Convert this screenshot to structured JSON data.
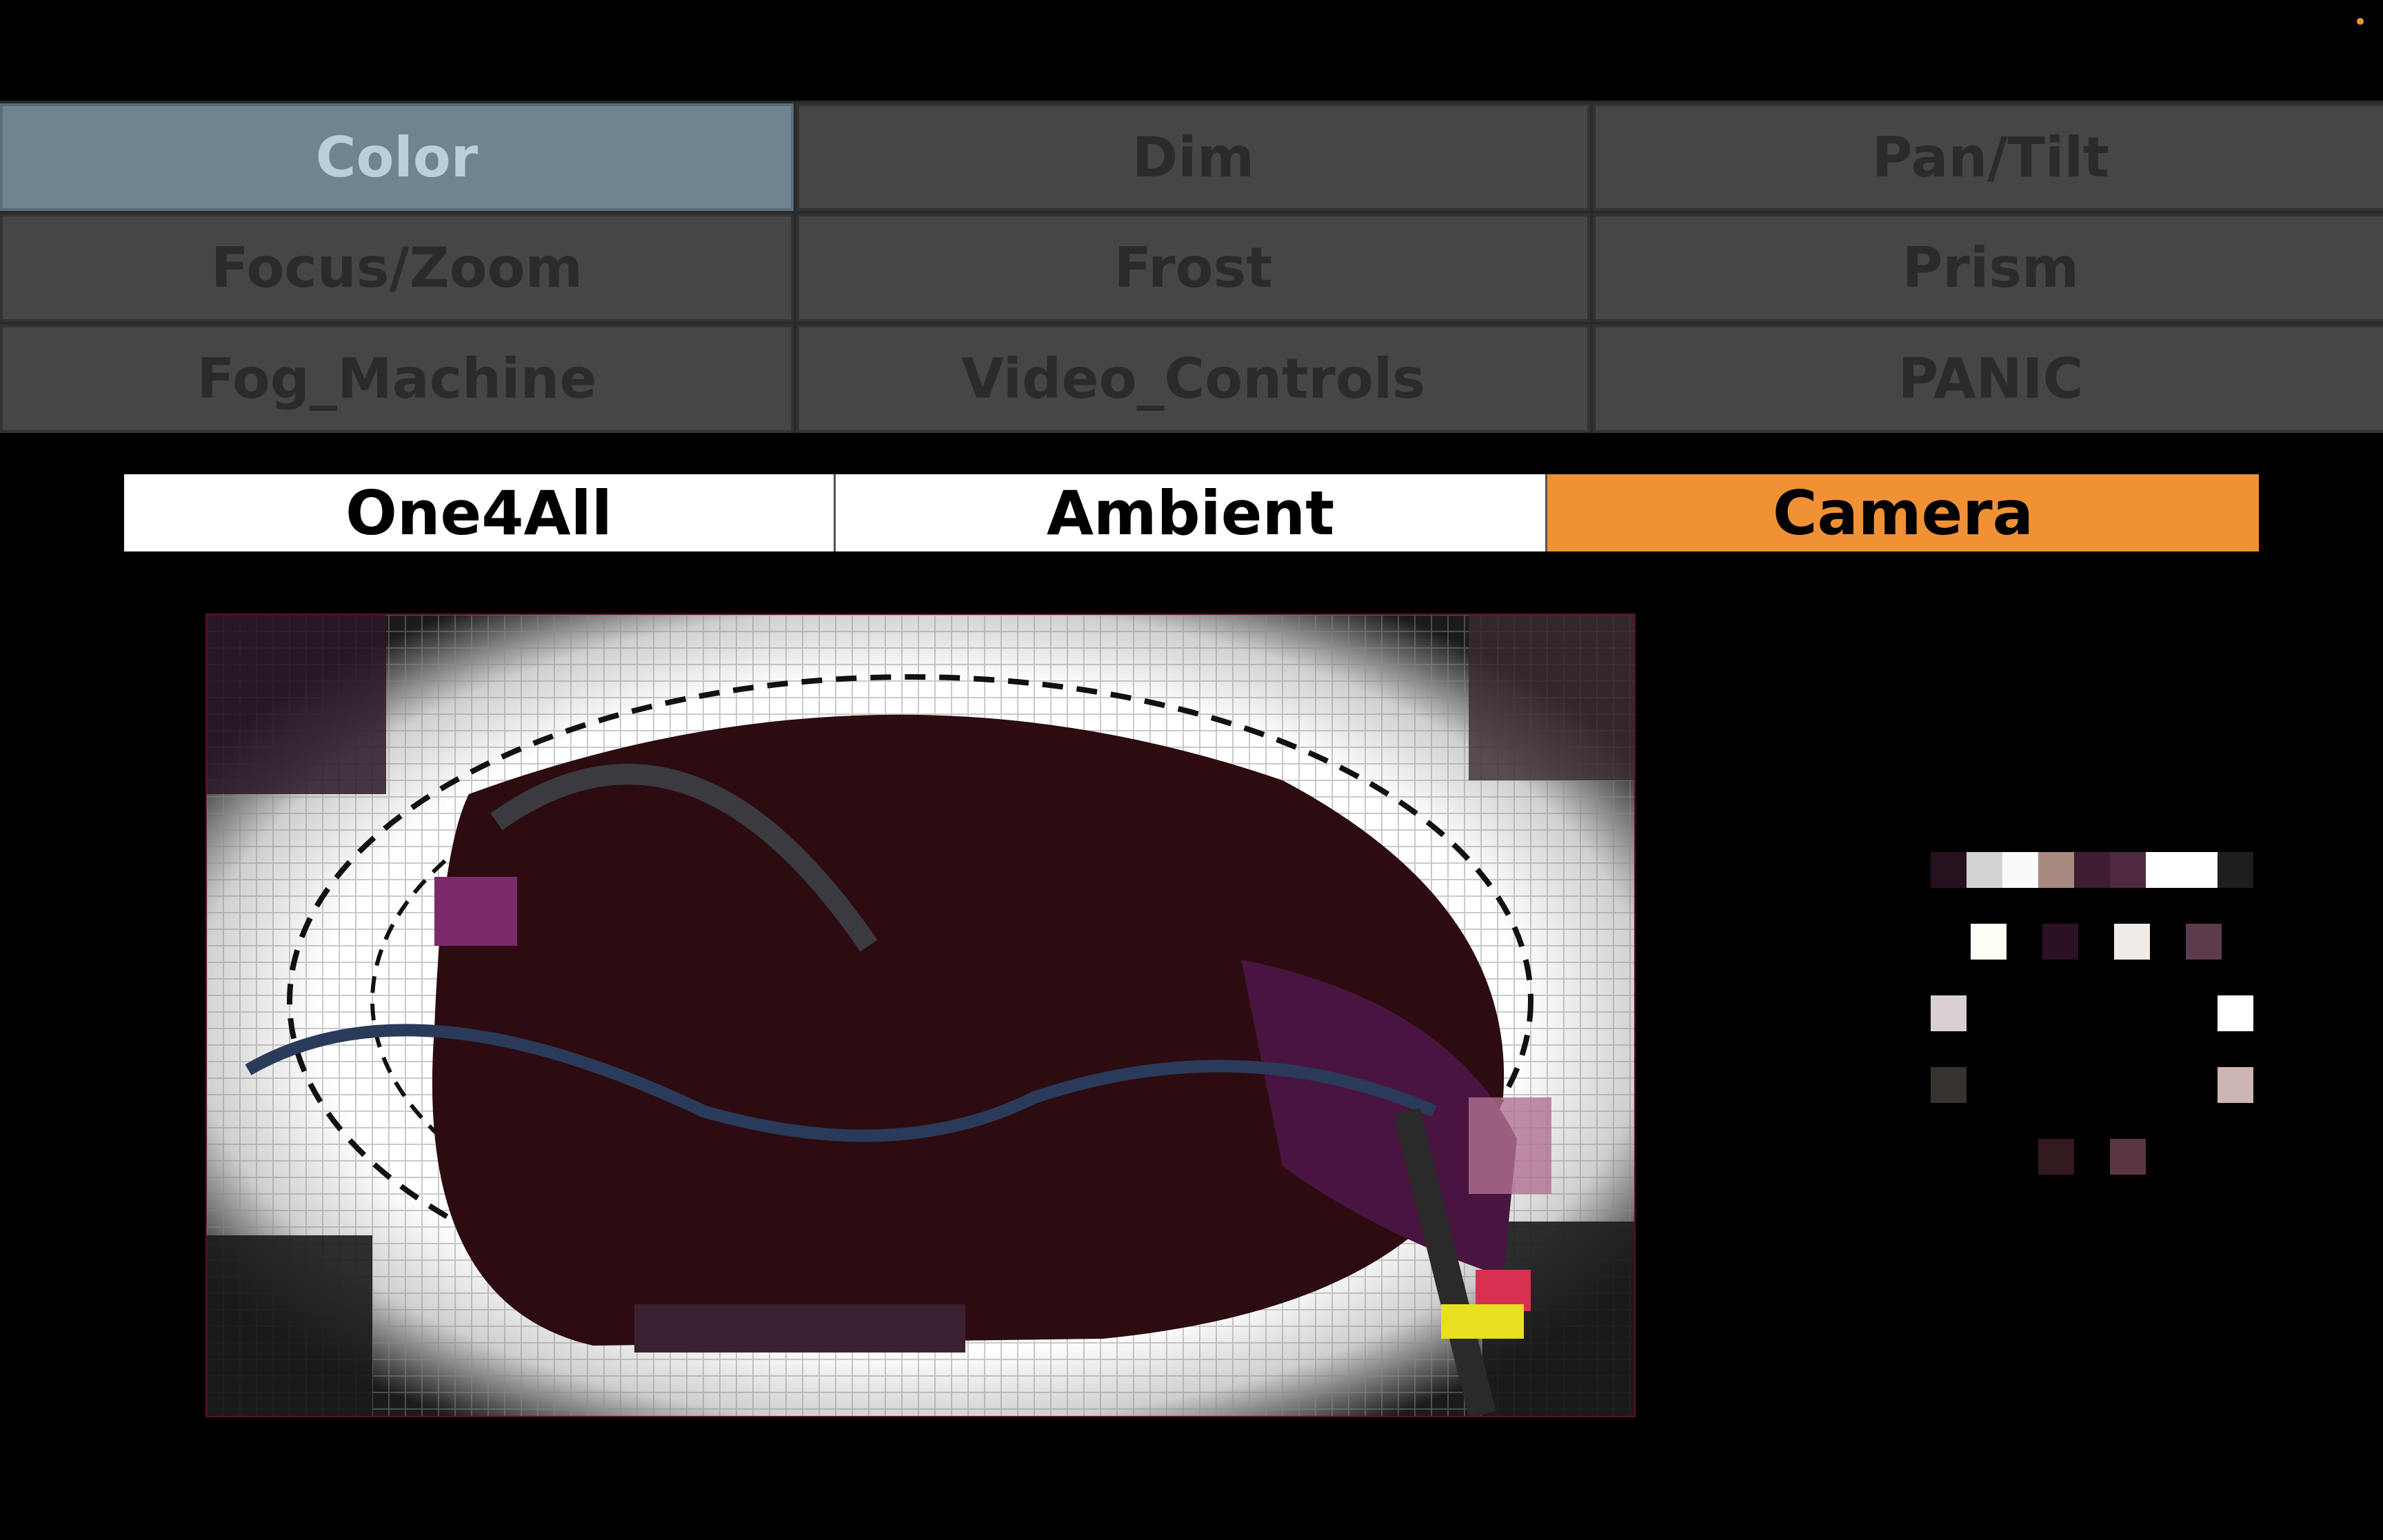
{
  "categories": [
    {
      "label": "Color",
      "active": true
    },
    {
      "label": "Dim",
      "active": false
    },
    {
      "label": "Pan/Tilt",
      "active": false
    },
    {
      "label": "Focus/Zoom",
      "active": false
    },
    {
      "label": "Frost",
      "active": false
    },
    {
      "label": "Prism",
      "active": false
    },
    {
      "label": "Fog_Machine",
      "active": false
    },
    {
      "label": "Video_Controls",
      "active": false
    },
    {
      "label": "PANIC",
      "active": false
    }
  ],
  "modes": [
    {
      "label": "One4All",
      "active": false
    },
    {
      "label": "Ambient",
      "active": false
    },
    {
      "label": "Camera",
      "active": true
    }
  ],
  "colors": {
    "accent": "#ef9134",
    "active_category": "#6e8591",
    "inactive_category": "#464646"
  },
  "swatches": {
    "top_row": [
      "#25101e",
      "#d2d2d2",
      "#fafafa",
      "#a88a80",
      "#3e1d31",
      "#4e2940",
      "#ffffff",
      "#ffffff",
      "#1e1e1e"
    ],
    "ring": [
      "#fffff5",
      "#2c1124",
      "#f0ebe6",
      "#5c3b4c",
      "#d8d0d2",
      "#ffffff",
      "#36322e",
      "#cdb5b3",
      "#32191e",
      "#5a3644"
    ]
  }
}
